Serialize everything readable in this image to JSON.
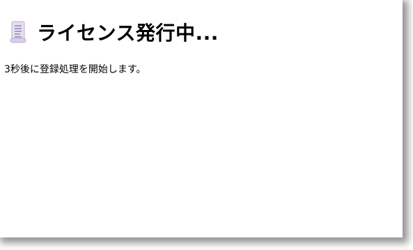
{
  "dialog": {
    "title": "ライセンス発行中...",
    "title_icon": "scroll-icon",
    "message": "3秒後に登録処理を開始します。"
  },
  "colors": {
    "background": "#ffffff",
    "text": "#000000",
    "icon_paper": "#e6dff0",
    "icon_lines": "#8a7fa8"
  }
}
